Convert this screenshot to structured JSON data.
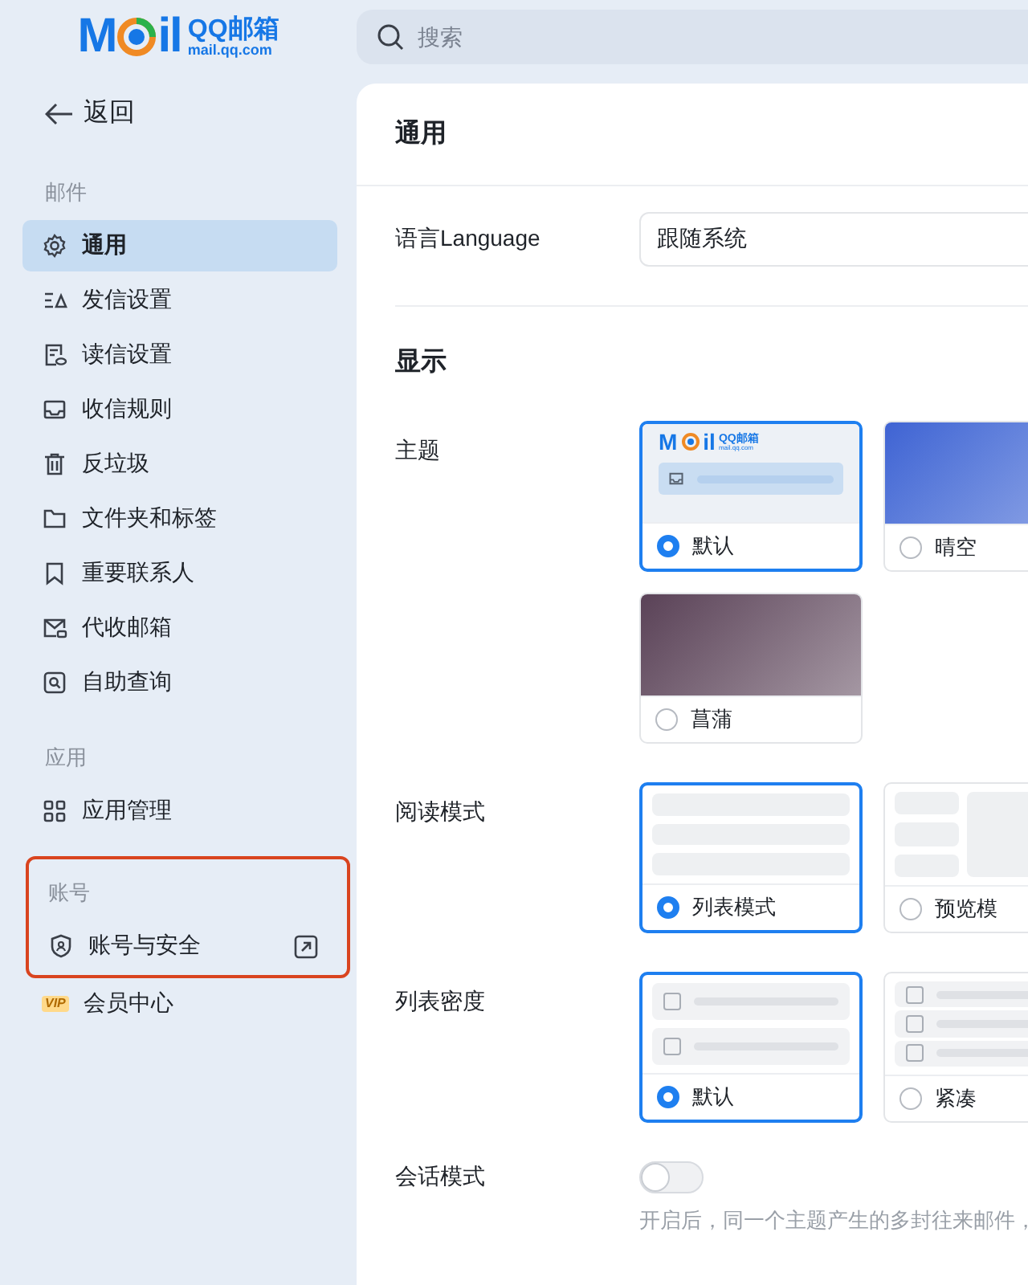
{
  "logo": {
    "mark_left": "M",
    "mark_right": "il",
    "name": "QQ邮箱",
    "domain": "mail.qq.com"
  },
  "search": {
    "placeholder": "搜索"
  },
  "sidebar": {
    "back": "返回",
    "sections": [
      {
        "title": "邮件",
        "highlighted": false,
        "items": [
          {
            "label": "通用",
            "selected": true
          },
          {
            "label": "发信设置",
            "selected": false
          },
          {
            "label": "读信设置",
            "selected": false
          },
          {
            "label": "收信规则",
            "selected": false
          },
          {
            "label": "反垃圾",
            "selected": false
          },
          {
            "label": "文件夹和标签",
            "selected": false
          },
          {
            "label": "重要联系人",
            "selected": false
          },
          {
            "label": "代收邮箱",
            "selected": false
          },
          {
            "label": "自助查询",
            "selected": false
          }
        ]
      },
      {
        "title": "应用",
        "highlighted": false,
        "items": [
          {
            "label": "应用管理",
            "selected": false
          }
        ]
      },
      {
        "title": "账号",
        "highlighted": true,
        "items": [
          {
            "label": "账号与安全",
            "selected": false,
            "external": true
          }
        ]
      }
    ],
    "extra_items": [
      {
        "label": "会员中心",
        "badge": "VIP"
      }
    ]
  },
  "main": {
    "title": "通用",
    "language": {
      "label": "语言Language",
      "value": "跟随系统"
    },
    "display_title": "显示",
    "groups": [
      {
        "label": "主题",
        "options": [
          {
            "label": "默认",
            "selected": true,
            "kind": "logo",
            "logo": {
              "mark_left": "M",
              "mark_right": "il",
              "name": "QQ邮箱",
              "domain": "mail.qq.com"
            }
          },
          {
            "label": "晴空",
            "selected": false,
            "kind": "gradient",
            "color": "#3f63d3"
          },
          {
            "label": "菖蒲",
            "selected": false,
            "kind": "gradient",
            "color": "#5a4257"
          }
        ]
      },
      {
        "label": "阅读模式",
        "options": [
          {
            "label": "列表模式",
            "selected": true,
            "kind": "list"
          },
          {
            "label": "预览模",
            "selected": false,
            "kind": "split"
          }
        ]
      },
      {
        "label": "列表密度",
        "options": [
          {
            "label": "默认",
            "selected": true,
            "kind": "rows"
          },
          {
            "label": "紧凑",
            "selected": false,
            "kind": "compact"
          }
        ]
      }
    ],
    "session": {
      "label": "会话模式",
      "on": false,
      "hint": "开启后，同一个主题产生的多封往来邮件，"
    }
  }
}
